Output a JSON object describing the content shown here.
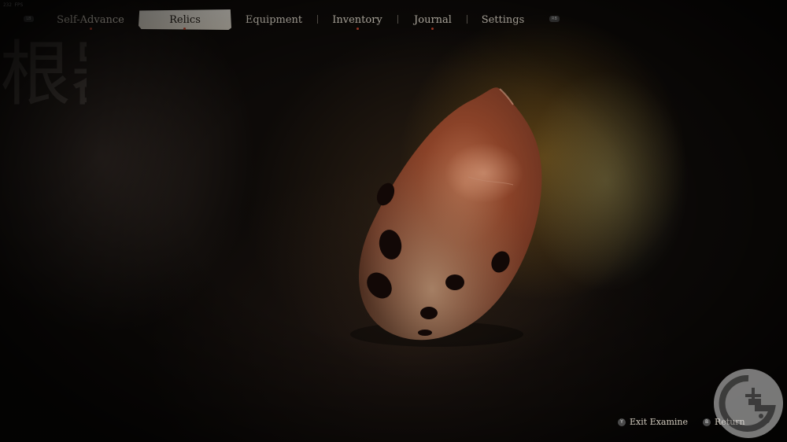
{
  "hud": {
    "fps": "232 FPS"
  },
  "nav": {
    "left_bumper": "LB",
    "right_bumper": "RB",
    "tabs": [
      {
        "label": "Self-Advance",
        "notification": true
      },
      {
        "label": "Relics",
        "notification": true,
        "selected": true
      },
      {
        "label": "Equipment",
        "notification": false
      },
      {
        "label": "Inventory",
        "notification": true
      },
      {
        "label": "Journal",
        "notification": true
      },
      {
        "label": "Settings",
        "notification": false
      }
    ]
  },
  "background": {
    "calligraphy": "根器"
  },
  "prompts": [
    {
      "button": "Y",
      "label": "Exit Examine"
    },
    {
      "button": "B",
      "label": "Return"
    }
  ],
  "colors": {
    "active_tab_bg": "#e2ddd2",
    "notification_dot": "#b8412c",
    "relic_body": "#7a3a22"
  },
  "icons": {
    "relic": "ocarina-relic",
    "watermark": "site-logo-watermark"
  }
}
